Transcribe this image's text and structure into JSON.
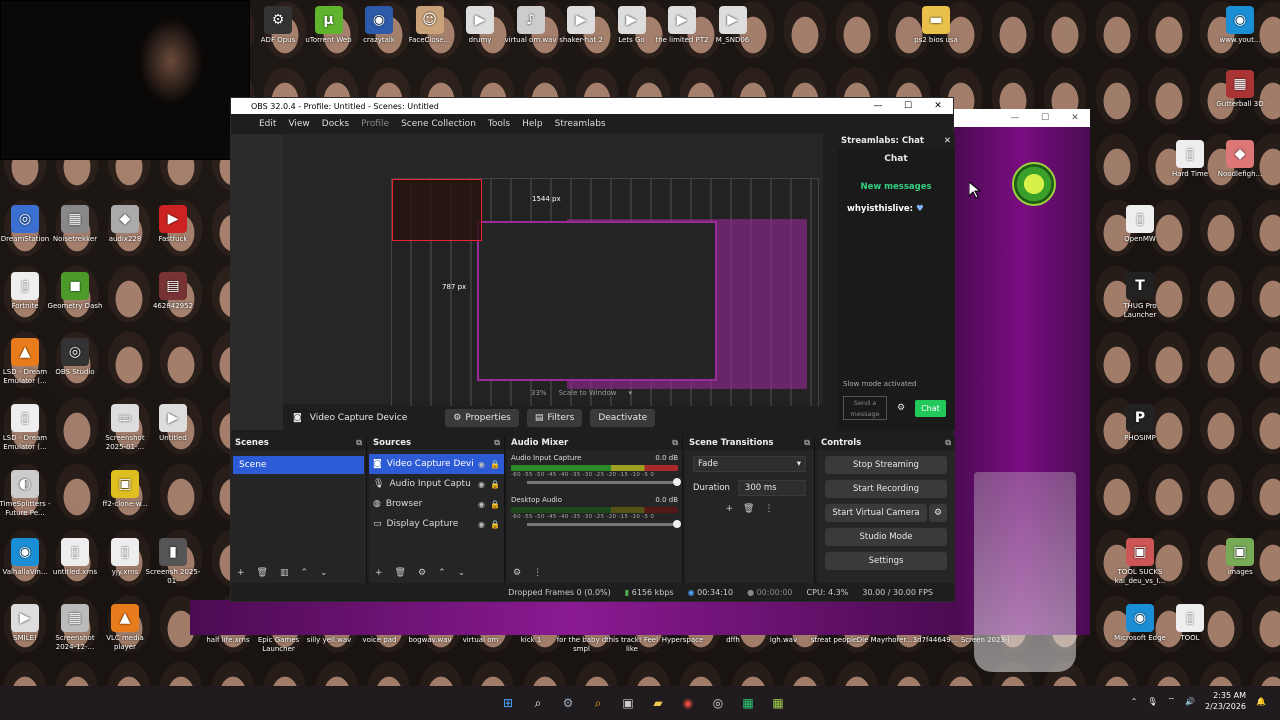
{
  "desktop": {
    "icons_top": [
      {
        "label": "ADF Opus",
        "glyph": "⚙",
        "color": "#333"
      },
      {
        "label": "uTorrent Web",
        "glyph": "μ",
        "color": "#5fb32d"
      },
      {
        "label": "crazytalk",
        "glyph": "◉",
        "color": "#2d5aa8"
      },
      {
        "label": "FaceClose...",
        "glyph": "☺",
        "color": "#c9a27a"
      },
      {
        "label": "drumy",
        "glyph": "▶",
        "color": "#ddd"
      },
      {
        "label": "virtual om.wav",
        "glyph": "♪",
        "color": "#ccc"
      },
      {
        "label": "shaker-hat 2",
        "glyph": "▶",
        "color": "#ddd"
      },
      {
        "label": "Lets Go",
        "glyph": "▶",
        "color": "#ddd"
      },
      {
        "label": "the limited PT2",
        "glyph": "▶",
        "color": "#ddd"
      },
      {
        "label": "M_SND06",
        "glyph": "▶",
        "color": "#ddd"
      }
    ],
    "icons_left": [
      {
        "label": "DreamStation",
        "glyph": "◎",
        "color": "#3b6fd1"
      },
      {
        "label": "Noisetrekker",
        "glyph": "▦",
        "color": "#888"
      },
      {
        "label": "audix228",
        "glyph": "◆",
        "color": "#aaa"
      },
      {
        "label": "Fastfuck",
        "glyph": "▶",
        "color": "#c22"
      },
      {
        "label": "Fortnite",
        "glyph": "▯",
        "color": "#eee"
      },
      {
        "label": "Geometry Dash",
        "glyph": "◼",
        "color": "#4c9b2a"
      },
      {
        "label": "462842952",
        "glyph": "▤",
        "color": "#733"
      },
      {
        "label": "LSD - Dream Emulator (...",
        "glyph": "▲",
        "color": "#e87b1b"
      },
      {
        "label": "OBS Studio",
        "glyph": "◎",
        "color": "#333"
      },
      {
        "label": "LSD - Dream Emulator (...",
        "glyph": "▯",
        "color": "#eee"
      },
      {
        "label": "Screenshot 2025-01-...",
        "glyph": "▭",
        "color": "#ddd"
      },
      {
        "label": "Untitled",
        "glyph": "▶",
        "color": "#ddd"
      },
      {
        "label": "TimeSplitters - Future Pe...",
        "glyph": "◐",
        "color": "#ccc"
      },
      {
        "label": "ff2-clone-w...",
        "glyph": "▣",
        "color": "#e0c020"
      },
      {
        "label": "ValhallaVin...",
        "glyph": "◉",
        "color": "#1b8fd6"
      },
      {
        "label": "untitled.xrns",
        "glyph": "▯",
        "color": "#eee"
      },
      {
        "label": "yjy.xrns",
        "glyph": "▯",
        "color": "#eee"
      },
      {
        "label": "Screensh 2025-01-",
        "glyph": "▮",
        "color": "#555"
      },
      {
        "label": "SMILE!",
        "glyph": "▶",
        "color": "#ddd"
      },
      {
        "label": "Screenshot 2024-12-...",
        "glyph": "▦",
        "color": "#bbb"
      },
      {
        "label": "VLC media player",
        "glyph": "▲",
        "color": "#e87b1b"
      }
    ],
    "icons_bottom": [
      "half life.xrns",
      "Epic Games Launcher",
      "silly yell.wav",
      "voice pad",
      "bogwav.wav",
      "virtual om",
      "kick 1",
      "for the baby d smpl",
      "this track! Feel like",
      "Hyperspace",
      "dffh",
      "igh.wav",
      "streat people",
      "Die Mayrhofer...",
      "3d7f44649...",
      "Screen 2023-("
    ],
    "icons_right": [
      {
        "label": "ps2 bios usa",
        "glyph": "▬",
        "color": "#e8c04a"
      },
      {
        "label": "www.yout...",
        "glyph": "◉",
        "color": "#1b8fd6"
      },
      {
        "label": "Gutterball 3D",
        "glyph": "▦",
        "color": "#a33"
      },
      {
        "label": "Hard Time",
        "glyph": "▯",
        "color": "#eee"
      },
      {
        "label": "Noodlefigh...",
        "glyph": "◆",
        "color": "#d77"
      },
      {
        "label": "OpenMW",
        "glyph": "▯",
        "color": "#eee"
      },
      {
        "label": "THUG Pro Launcher",
        "glyph": "T",
        "color": "#222"
      },
      {
        "label": "PHOSIMP",
        "glyph": "P",
        "color": "#222"
      },
      {
        "label": "TOOL SUCKS kai_deu_vs_I...",
        "glyph": "▣",
        "color": "#c55"
      },
      {
        "label": "images",
        "glyph": "▣",
        "color": "#7a5"
      },
      {
        "label": "Microsoft Edge",
        "glyph": "◉",
        "color": "#1b8fd6"
      },
      {
        "label": "TOOL",
        "glyph": "▯",
        "color": "#eee"
      }
    ]
  },
  "obs": {
    "title": "OBS 32.0.4 - Profile: Untitled - Scenes: Untitled",
    "menu": [
      "Edit",
      "View",
      "Docks",
      "Profile",
      "Scene Collection",
      "Tools",
      "Help",
      "Streamlabs"
    ],
    "preview": {
      "dims_w": "1544 px",
      "dims_h": "787 px",
      "zoom": "33%",
      "scale_mode": "Scale to Window"
    },
    "context_bar": {
      "source": "Video Capture Device",
      "properties": "Properties",
      "filters": "Filters",
      "deactivate": "Deactivate"
    },
    "scenes": {
      "title": "Scenes",
      "items": [
        "Scene"
      ]
    },
    "sources": {
      "title": "Sources",
      "items": [
        {
          "name": "Video Capture Devi",
          "icon": "camera-icon"
        },
        {
          "name": "Audio Input Captu",
          "icon": "mic-icon"
        },
        {
          "name": "Browser",
          "icon": "globe-icon"
        },
        {
          "name": "Display Capture",
          "icon": "monitor-icon"
        }
      ]
    },
    "mixer": {
      "title": "Audio Mixer",
      "tracks": [
        {
          "name": "Audio Input Capture",
          "db": "0.0 dB",
          "active": true
        },
        {
          "name": "Desktop Audio",
          "db": "0.0 dB",
          "active": false
        }
      ],
      "ticks": "-60 -55 -50 -45 -40 -35 -30 -25 -20 -15 -10 -5 0"
    },
    "transitions": {
      "title": "Scene Transitions",
      "selected": "Fade",
      "duration_label": "Duration",
      "duration_value": "300 ms"
    },
    "controls": {
      "title": "Controls",
      "buttons": [
        "Stop Streaming",
        "Start Recording",
        "Start Virtual Camera",
        "Studio Mode",
        "Settings"
      ]
    },
    "status": {
      "dropped": "Dropped Frames 0 (0.0%)",
      "bitrate": "6156 kbps",
      "stream_time": "00:34:10",
      "rec_time": "00:00:00",
      "cpu": "CPU: 4.3%",
      "fps": "30.00 / 30.00 FPS"
    },
    "chat": {
      "dock_title": "Streamlabs: Chat",
      "label": "Chat",
      "new_messages": "New messages",
      "user": "whyisthislive:",
      "slow_mode": "Slow mode activated",
      "send_placeholder": "Send a message",
      "chat_button": "Chat"
    }
  },
  "taskbar": {
    "apps": [
      "windows",
      "search",
      "settings",
      "search2",
      "terminal",
      "folder",
      "chrome",
      "obs",
      "app1",
      "app2"
    ],
    "time": "2:35 AM",
    "date": "2/23/2026"
  }
}
